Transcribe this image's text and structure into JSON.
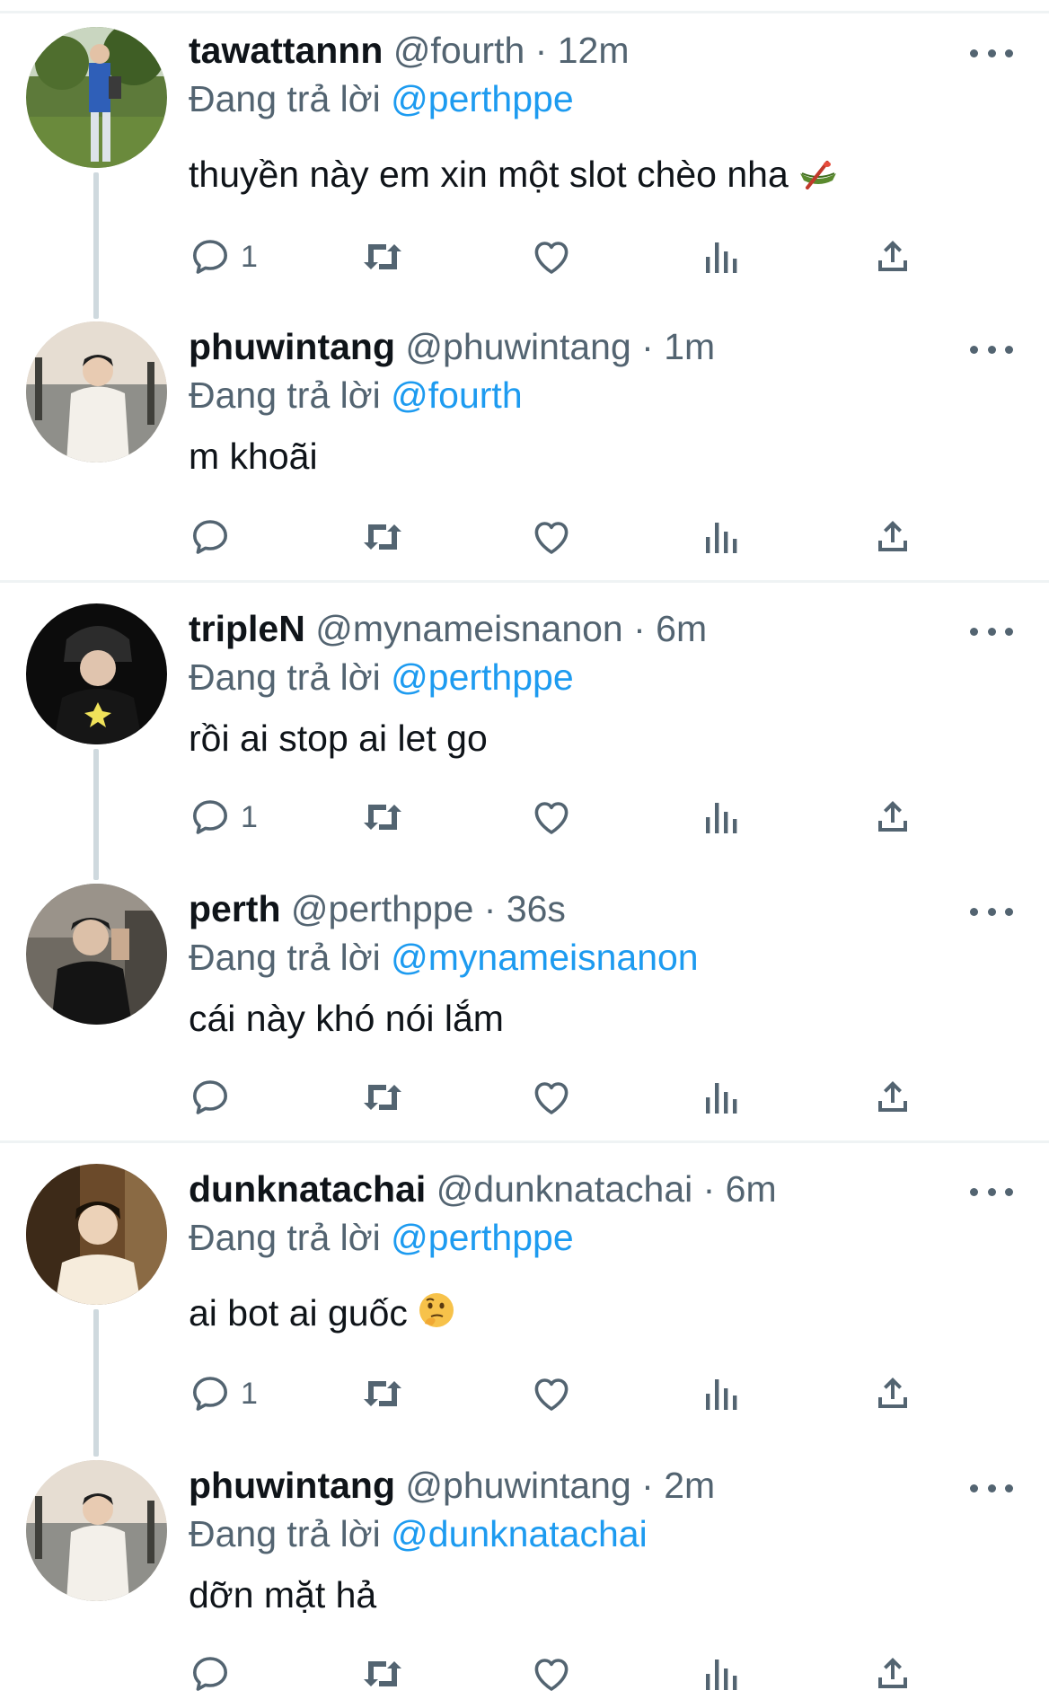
{
  "reply_prefix": "Đang trả lời",
  "tweets": [
    {
      "name": "tawattannn",
      "meta": "@fourth · 12m",
      "reply_to": "@perthppe",
      "text": "thuyền này em xin một slot chèo nha",
      "emoji": "canoe",
      "reply_count": "1"
    },
    {
      "name": "phuwintang",
      "meta": "@phuwintang · 1m",
      "reply_to": "@fourth",
      "text": "m khoãi",
      "reply_count": ""
    },
    {
      "name": "tripleN",
      "meta": "@mynameisnanon · 6m",
      "reply_to": "@perthppe",
      "text": "rồi ai stop ai let go",
      "reply_count": "1"
    },
    {
      "name": "perth",
      "meta": "@perthppe · 36s",
      "reply_to": "@mynameisnanon",
      "text": "cái này khó nói lắm",
      "reply_count": ""
    },
    {
      "name": "dunknatachai",
      "meta": "@dunknatachai · 6m",
      "reply_to": "@perthppe",
      "text": "ai bot ai guốc",
      "emoji": "thinking-face",
      "reply_count": "1"
    },
    {
      "name": "phuwintang",
      "meta": "@phuwintang · 2m",
      "reply_to": "@dunknatachai",
      "text": "dỡn mặt hả",
      "reply_count": ""
    }
  ],
  "icons": {
    "reply": "reply-bubble-icon",
    "retweet": "retweet-icon",
    "like": "heart-icon",
    "views": "views-bar-chart-icon",
    "share": "share-upload-icon",
    "more": "more-dots-icon"
  },
  "colors": {
    "link": "#1d9bf0",
    "secondary": "#536471",
    "text": "#0f1419",
    "thread_line": "#cfd9de",
    "divider": "#eff3f4"
  }
}
